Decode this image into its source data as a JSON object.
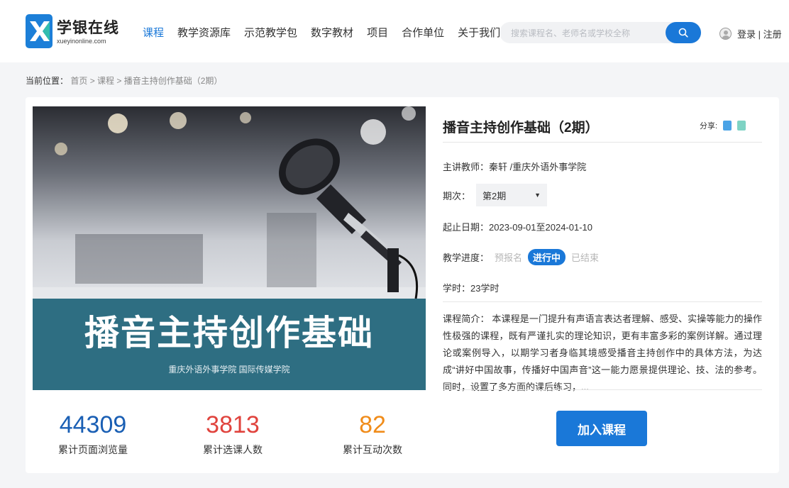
{
  "header": {
    "logo_cn": "学银在线",
    "logo_en": "xueyinonline.com",
    "nav": [
      "课程",
      "教学资源库",
      "示范教学包",
      "数字教材",
      "项目",
      "合作单位",
      "关于我们"
    ],
    "search_placeholder": "搜索课程名、老师名或学校全称",
    "login_text": "登录 | 注册"
  },
  "breadcrumb": {
    "label": "当前位置：",
    "path": "首页 > 课程 > 播音主持创作基础（2期）"
  },
  "cover": {
    "title": "播音主持创作基础",
    "subtitle": "重庆外语外事学院 国际传媒学院"
  },
  "stats": [
    {
      "value": "44309",
      "label": "累计页面浏览量",
      "color": "#1a5fb4"
    },
    {
      "value": "3813",
      "label": "累计选课人数",
      "color": "#e0433d"
    },
    {
      "value": "82",
      "label": "累计互动次数",
      "color": "#f08c1a"
    }
  ],
  "course": {
    "title": "播音主持创作基础（2期）",
    "share_label": "分享:",
    "teacher": "主讲教师：秦轩 /重庆外语外事学院",
    "term_label": "期次：",
    "term_value": "第2期",
    "dates": "起止日期：2023-09-01至2024-01-10",
    "progress_label": "教学进度：",
    "progress_states": [
      "预报名",
      "进行中",
      "已结束"
    ],
    "progress_active": "进行中",
    "hours": "学时：23学时",
    "intro": "课程简介：  本课程是一门提升有声语言表达者理解、感受、实操等能力的操作性极强的课程，既有严谨扎实的理论知识，更有丰富多彩的案例详解。通过理论或案例导入，以期学习者身临其境感受播音主持创作中的具体方法，为达成“讲好中国故事，传播好中国声音”这一能力愿景提供理论、技、法的参考。同时，设置了多方面的课后练习，...",
    "join_button": "加入课程"
  },
  "colors": {
    "accent": "#1a78d8",
    "cover_band": "#2e6e82"
  }
}
